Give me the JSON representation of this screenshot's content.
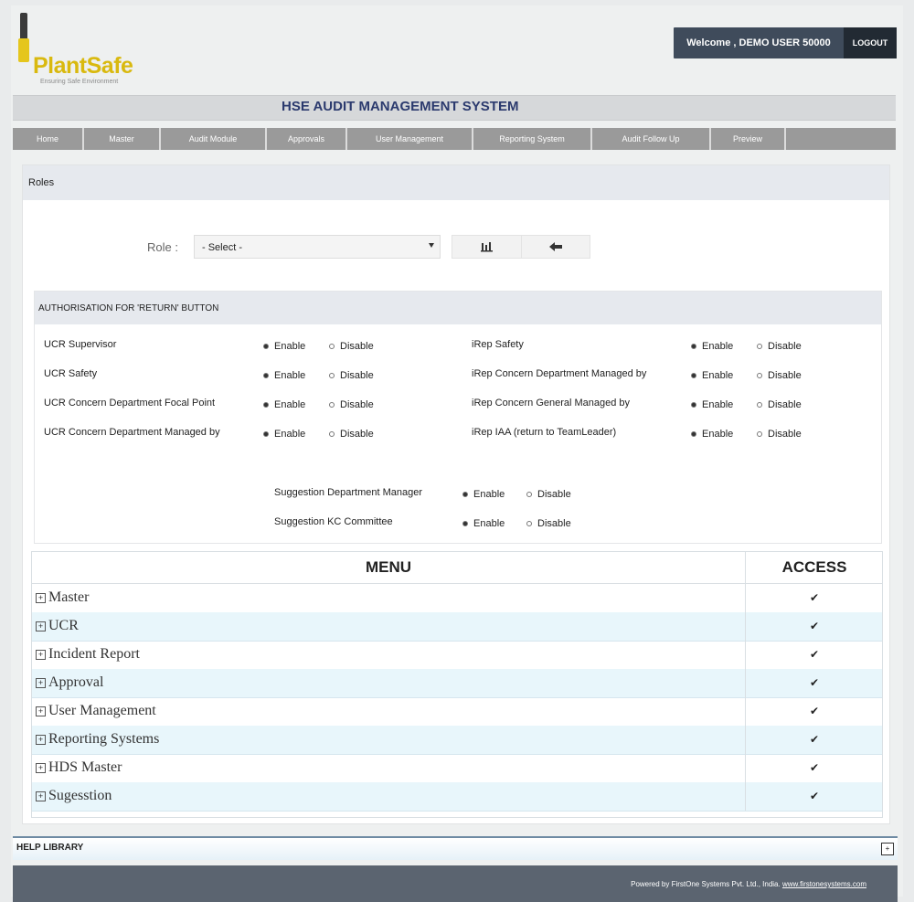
{
  "header": {
    "brand": "PlantSafe",
    "tagline": "Ensuring Safe Environment",
    "welcome": "Welcome , DEMO USER 50000",
    "logout": "LOGOUT",
    "system_title": "HSE AUDIT MANAGEMENT SYSTEM"
  },
  "nav": [
    {
      "label": "Home"
    },
    {
      "label": "Master"
    },
    {
      "label": "Audit Module"
    },
    {
      "label": "Approvals"
    },
    {
      "label": "User Management"
    },
    {
      "label": "Reporting System"
    },
    {
      "label": "Audit Follow Up"
    },
    {
      "label": "Preview"
    }
  ],
  "page": {
    "section_title": "Roles",
    "role_label": "Role :",
    "role_select_value": "- Select -",
    "icons": {
      "save": "save-icon",
      "back": "back-arrow-icon"
    }
  },
  "auth": {
    "title": "AUTHORISATION FOR 'RETURN' BUTTON",
    "enable_label": "Enable",
    "disable_label": "Disable",
    "left": [
      {
        "label": "UCR Supervisor",
        "state": "enable"
      },
      {
        "label": "UCR Safety",
        "state": "enable"
      },
      {
        "label": "UCR Concern Department Focal Point",
        "state": "enable"
      },
      {
        "label": "UCR Concern Department Managed by",
        "state": "enable"
      }
    ],
    "right": [
      {
        "label": "iRep Safety",
        "state": "enable"
      },
      {
        "label": "iRep Concern Department Managed by",
        "state": "enable"
      },
      {
        "label": "iRep Concern General Managed by",
        "state": "enable"
      },
      {
        "label": "iRep IAA (return to TeamLeader)",
        "state": "enable"
      }
    ],
    "center": [
      {
        "label": "Suggestion Department Manager",
        "state": "enable"
      },
      {
        "label": "Suggestion KC Committee",
        "state": "enable"
      }
    ]
  },
  "menu_table": {
    "col_menu": "MENU",
    "col_access": "ACCESS",
    "rows": [
      {
        "label": "Master",
        "access": "✔"
      },
      {
        "label": "UCR",
        "access": "✔"
      },
      {
        "label": "Incident Report",
        "access": "✔"
      },
      {
        "label": "Approval",
        "access": "✔"
      },
      {
        "label": "User Management",
        "access": "✔"
      },
      {
        "label": "Reporting Systems",
        "access": "✔"
      },
      {
        "label": "HDS Master",
        "access": "✔"
      },
      {
        "label": "Sugesstion",
        "access": "✔"
      }
    ]
  },
  "help": {
    "label": "HELP LIBRARY",
    "toggle": "+"
  },
  "footer": {
    "powered": "Powered by FirstOne Systems Pvt. Ltd., India.",
    "link": "www.firstonesystems.com"
  }
}
